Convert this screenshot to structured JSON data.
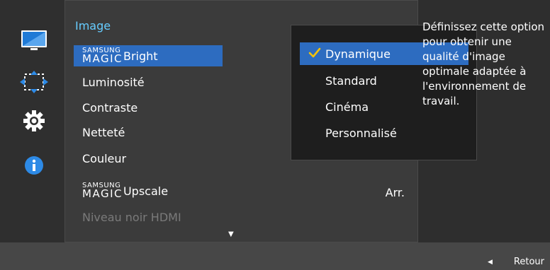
{
  "menu": {
    "title": "Image",
    "items": [
      {
        "brand_small": "SAMSUNG",
        "brand_big": "MAGIC",
        "label": "Bright",
        "selected": true
      },
      {
        "label": "Luminosité"
      },
      {
        "label": "Contraste"
      },
      {
        "label": "Netteté"
      },
      {
        "label": "Couleur"
      },
      {
        "brand_small": "SAMSUNG",
        "brand_big": "MAGIC",
        "label": "Upscale",
        "value": "Arr."
      },
      {
        "label": "Niveau noir HDMI",
        "disabled": true
      }
    ]
  },
  "submenu": {
    "options": [
      {
        "label": "Dynamique",
        "selected": true
      },
      {
        "label": "Standard"
      },
      {
        "label": "Cinéma"
      },
      {
        "label": "Personnalisé"
      }
    ]
  },
  "help": {
    "text": "Définissez cette option pour obtenir une qualité d'image optimale adaptée à l'environnement de travail."
  },
  "footer": {
    "back_label": "Retour"
  },
  "rail": {
    "icons": [
      "monitor-icon",
      "resize-icon",
      "gear-icon",
      "info-icon"
    ]
  },
  "colors": {
    "accent": "#2d6cc0",
    "title": "#66ccff",
    "disabled": "#7a7a7a"
  }
}
